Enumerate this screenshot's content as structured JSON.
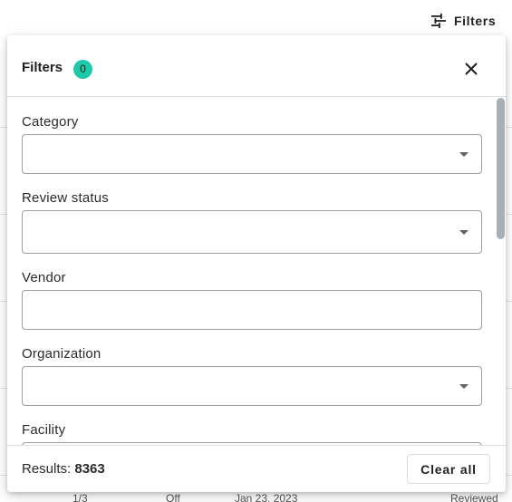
{
  "toolbar": {
    "filters_label": "Filters",
    "filters_icon": "tune-icon"
  },
  "panel": {
    "title": "Filters",
    "active_count": "0",
    "close_icon": "close-icon",
    "fields": [
      {
        "label": "Category",
        "type": "select",
        "value": ""
      },
      {
        "label": "Review status",
        "type": "select",
        "value": ""
      },
      {
        "label": "Vendor",
        "type": "text",
        "value": ""
      },
      {
        "label": "Organization",
        "type": "select",
        "value": ""
      },
      {
        "label": "Facility",
        "type": "select",
        "value": ""
      }
    ],
    "footer": {
      "results_label": "Results:",
      "results_count": "8363",
      "clear_label": "Clear all"
    }
  },
  "background_row": {
    "cells": [
      "1/3",
      "Off",
      "Jan 23, 2023",
      "Reviewed"
    ]
  },
  "colors": {
    "badge": "#1cc9a8",
    "border": "#9e9e9e",
    "scrollbar": "#a8b0b5"
  }
}
